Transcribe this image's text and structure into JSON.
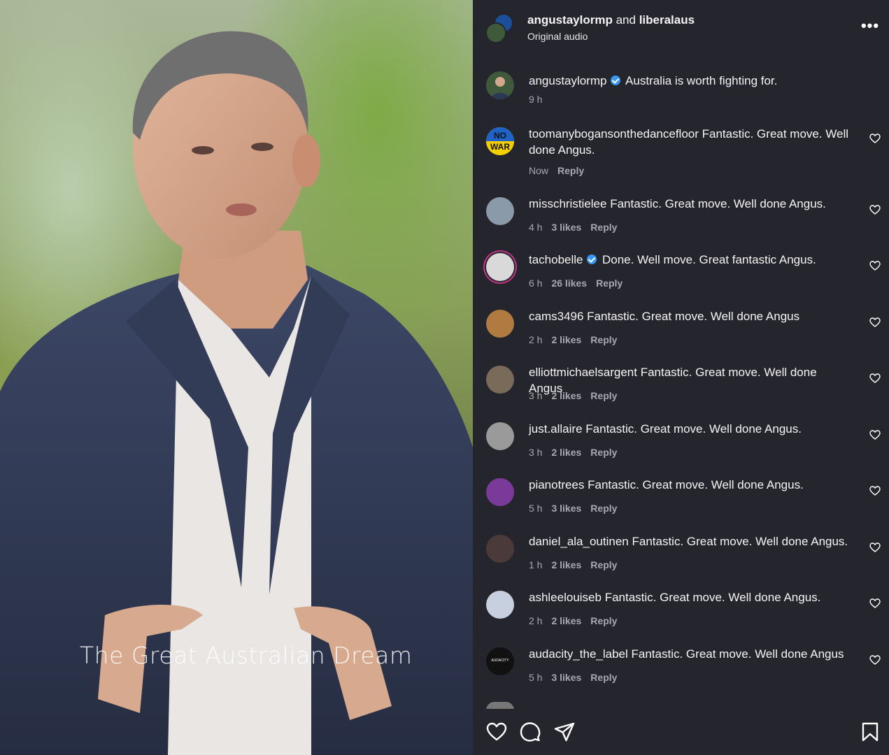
{
  "video": {
    "caption": "The Great Australian Dream"
  },
  "header": {
    "user1": "angustaylormp",
    "joiner": "and",
    "user2": "liberalaus",
    "audio": "Original audio",
    "more_icon": "more-horizontal-icon"
  },
  "caption_comment": {
    "user": "angustaylormp",
    "verified": true,
    "text": "Australia is worth fighting for.",
    "time": "9 h"
  },
  "comments": [
    {
      "user": "toomanybogansonthedancefloor",
      "text": "Fantastic. Great move. Well done Angus.",
      "time": "Now",
      "likes": "",
      "reply": "Reply",
      "avatar_color": "#f5d000"
    },
    {
      "user": "misschristielee",
      "text": "Fantastic. Great move. Well done Angus.",
      "time": "4 h",
      "likes": "3 likes",
      "reply": "Reply",
      "avatar_color": "#8a9aa8"
    },
    {
      "user": "tachobelle",
      "verified": true,
      "text": "Done. Well move. Great fantastic Angus.",
      "time": "6 h",
      "likes": "26 likes",
      "reply": "Reply",
      "avatar_color": "#d9d9d9"
    },
    {
      "user": "cams3496",
      "text": "Fantastic. Great move. Well done Angus",
      "time": "2 h",
      "likes": "2 likes",
      "reply": "Reply",
      "avatar_color": "#b07a40"
    },
    {
      "user": "elliottmichaelsargent",
      "text": "Fantastic. Great move. Well done Angus",
      "time": "3 h",
      "likes": "2 likes",
      "reply": "Reply",
      "avatar_color": "#7a6a5a"
    },
    {
      "user": "just.allaire",
      "text": "Fantastic. Great move. Well done Angus.",
      "time": "3 h",
      "likes": "2 likes",
      "reply": "Reply",
      "avatar_color": "#9a9a9a"
    },
    {
      "user": "pianotrees",
      "text": "Fantastic. Great move. Well done Angus.",
      "time": "5 h",
      "likes": "3 likes",
      "reply": "Reply",
      "avatar_color": "#7a3a9a"
    },
    {
      "user": "daniel_ala_outinen",
      "text": "Fantastic. Great move. Well done Angus.",
      "time": "1 h",
      "likes": "2 likes",
      "reply": "Reply",
      "avatar_color": "#4a3a3a"
    },
    {
      "user": "ashleelouiseb",
      "text": "Fantastic. Great move. Well done Angus.",
      "time": "2 h",
      "likes": "2 likes",
      "reply": "Reply",
      "avatar_color": "#c8d0e0"
    },
    {
      "user": "audacity_the_label",
      "text": "Fantastic. Great move. Well done Angus",
      "time": "5 h",
      "likes": "3 likes",
      "reply": "Reply",
      "avatar_color": "#111111",
      "avatar_text": "AUDACITY"
    }
  ],
  "colors": {
    "panel_bg": "#25252d",
    "meta_text": "#a8a8b0",
    "verified_blue": "#3897f0"
  },
  "footer": {
    "icons": [
      "heart-icon",
      "comment-icon",
      "share-icon",
      "bookmark-icon"
    ]
  }
}
